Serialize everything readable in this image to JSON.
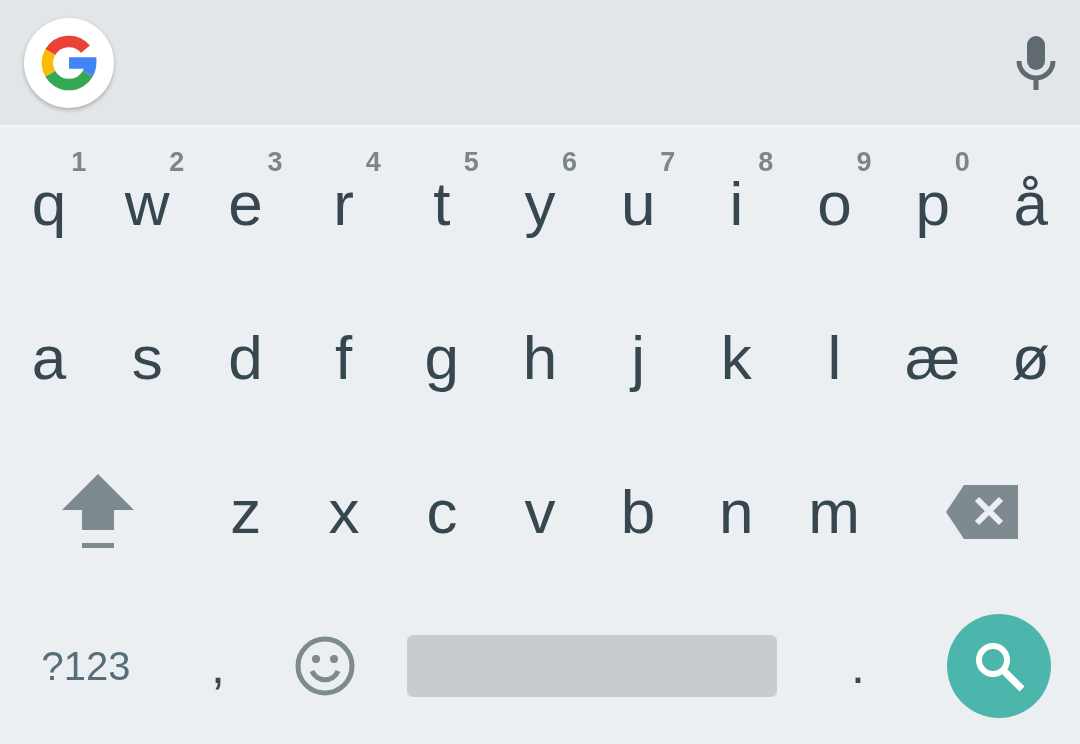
{
  "top_bar": {
    "google_button": {
      "kind": "google"
    },
    "voice_button": {
      "kind": "mic"
    }
  },
  "rows": [
    {
      "keys": [
        {
          "kind": "letter",
          "label": "q",
          "hint": "1"
        },
        {
          "kind": "letter",
          "label": "w",
          "hint": "2"
        },
        {
          "kind": "letter",
          "label": "e",
          "hint": "3"
        },
        {
          "kind": "letter",
          "label": "r",
          "hint": "4"
        },
        {
          "kind": "letter",
          "label": "t",
          "hint": "5"
        },
        {
          "kind": "letter",
          "label": "y",
          "hint": "6"
        },
        {
          "kind": "letter",
          "label": "u",
          "hint": "7"
        },
        {
          "kind": "letter",
          "label": "i",
          "hint": "8"
        },
        {
          "kind": "letter",
          "label": "o",
          "hint": "9"
        },
        {
          "kind": "letter",
          "label": "p",
          "hint": "0"
        },
        {
          "kind": "letter",
          "label": "å"
        }
      ]
    },
    {
      "keys": [
        {
          "kind": "letter",
          "label": "a"
        },
        {
          "kind": "letter",
          "label": "s"
        },
        {
          "kind": "letter",
          "label": "d"
        },
        {
          "kind": "letter",
          "label": "f"
        },
        {
          "kind": "letter",
          "label": "g"
        },
        {
          "kind": "letter",
          "label": "h"
        },
        {
          "kind": "letter",
          "label": "j"
        },
        {
          "kind": "letter",
          "label": "k"
        },
        {
          "kind": "letter",
          "label": "l"
        },
        {
          "kind": "letter",
          "label": "æ"
        },
        {
          "kind": "letter",
          "label": "ø"
        }
      ]
    },
    {
      "keys": [
        {
          "kind": "shift"
        },
        {
          "kind": "letter",
          "label": "z"
        },
        {
          "kind": "letter",
          "label": "x"
        },
        {
          "kind": "letter",
          "label": "c"
        },
        {
          "kind": "letter",
          "label": "v"
        },
        {
          "kind": "letter",
          "label": "b"
        },
        {
          "kind": "letter",
          "label": "n"
        },
        {
          "kind": "letter",
          "label": "m"
        },
        {
          "kind": "backspace"
        }
      ]
    },
    {
      "keys": [
        {
          "kind": "symbols",
          "label": "?123"
        },
        {
          "kind": "comma",
          "label": ","
        },
        {
          "kind": "emoji"
        },
        {
          "kind": "space"
        },
        {
          "kind": "period",
          "label": "."
        },
        {
          "kind": "search"
        }
      ]
    }
  ]
}
